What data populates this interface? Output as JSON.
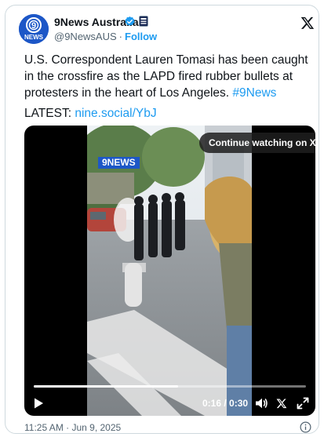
{
  "author": {
    "name": "9News Australia",
    "handle": "@9NewsAUS",
    "separator": "·",
    "follow_label": "Follow",
    "avatar_text_top": "9",
    "avatar_text_bottom": "NEWS"
  },
  "tweet": {
    "text_main": "U.S. Correspondent Lauren Tomasi has been caught in the crossfire as the LAPD fired rubber bullets at protesters in the heart of Los Angeles. ",
    "hashtag": "#9News",
    "latest_label": "LATEST: ",
    "latest_link": "nine.social/YbJ",
    "timestamp": "11:25 AM · Jun 9, 2025"
  },
  "video": {
    "continue_label": "Continue watching on X",
    "time_display": "0:16 / 0:30",
    "progress": 0.53,
    "overlay_logo": "9NEWS"
  },
  "colors": {
    "link": "#1d9bf0",
    "verified": "#1d9bf0",
    "avatar_bg": "#1d57c7"
  },
  "icons": [
    "verified-badge-icon",
    "affiliate-badge-icon",
    "x-logo-icon",
    "play-icon",
    "volume-icon",
    "x-icon",
    "expand-icon",
    "info-icon"
  ]
}
